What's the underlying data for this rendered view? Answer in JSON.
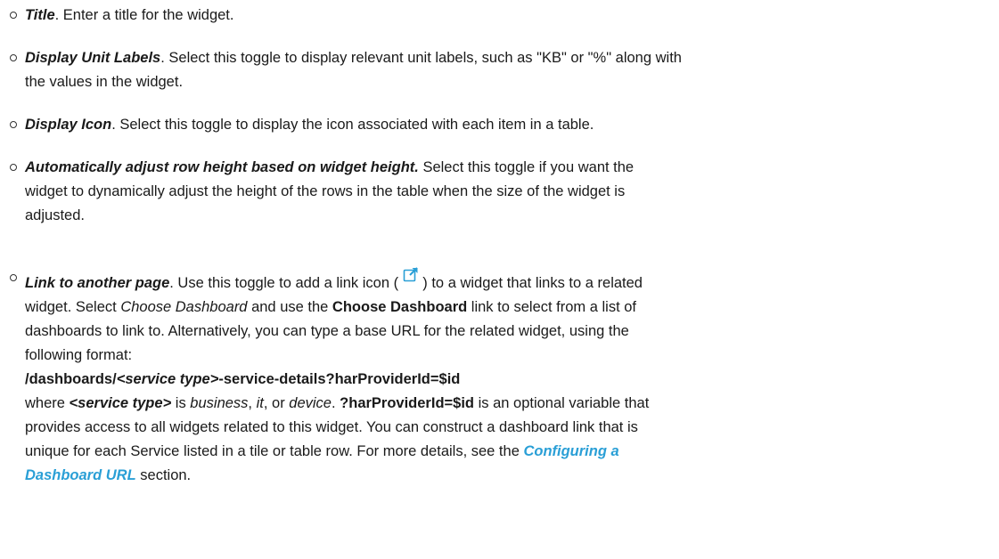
{
  "items": [
    {
      "term": "Title",
      "text": ". Enter a title for the widget."
    },
    {
      "term": "Display Unit Labels",
      "text_line1": ". Select this toggle to display relevant unit labels, such as \"KB\" or \"%\" along with",
      "text_line2": "the values in the widget."
    },
    {
      "term": "Display Icon",
      "text": ". Select this toggle to display the icon associated with each item in a table."
    },
    {
      "term": "Automatically adjust row height based on widget height.",
      "text_line1": " Select this toggle if you want the",
      "text_line2": "widget to dynamically adjust the height of the rows in the table when the size of the widget is",
      "text_line3": "adjusted."
    },
    {
      "term": "Link to another page",
      "text_a": ". Use this toggle to add a link icon (",
      "link_icon": "external-link-icon",
      "text_b": ") to a widget that links to a related",
      "line2": "widget. Select ",
      "line2_em": "Choose Dashboard",
      "line2_mid": " and use the ",
      "line2_bold": "Choose Dashboard",
      "line2_end": " link to select from a list of",
      "line3": "dashboards to link to. Alternatively, you can type a base URL for the related widget, using the",
      "line4": "following format:",
      "url_a": "/dashboards/",
      "url_em": "<service type>",
      "url_b": "-service-details?harProviderId=$id",
      "line6_a": "where ",
      "line6_em_bold": "<service type>",
      "line6_b": " is ",
      "line6_em1": "business",
      "line6_c": ", ",
      "line6_em2": "it",
      "line6_d": ", or ",
      "line6_em3": "device",
      "line6_e": ". ",
      "line6_bold": "?harProviderId=$id",
      "line6_f": " is an optional variable that",
      "line7": "provides access to all widgets related to this widget. You can construct a dashboard link that is",
      "line8_a": "unique for each Service listed in a tile or table row. For more details, see the ",
      "link_text_1": "Configuring a",
      "link_text_2": "Dashboard URL",
      "line9_end": " section."
    }
  ],
  "colors": {
    "text": "#1a1a1a",
    "link": "#2a9fd6"
  }
}
